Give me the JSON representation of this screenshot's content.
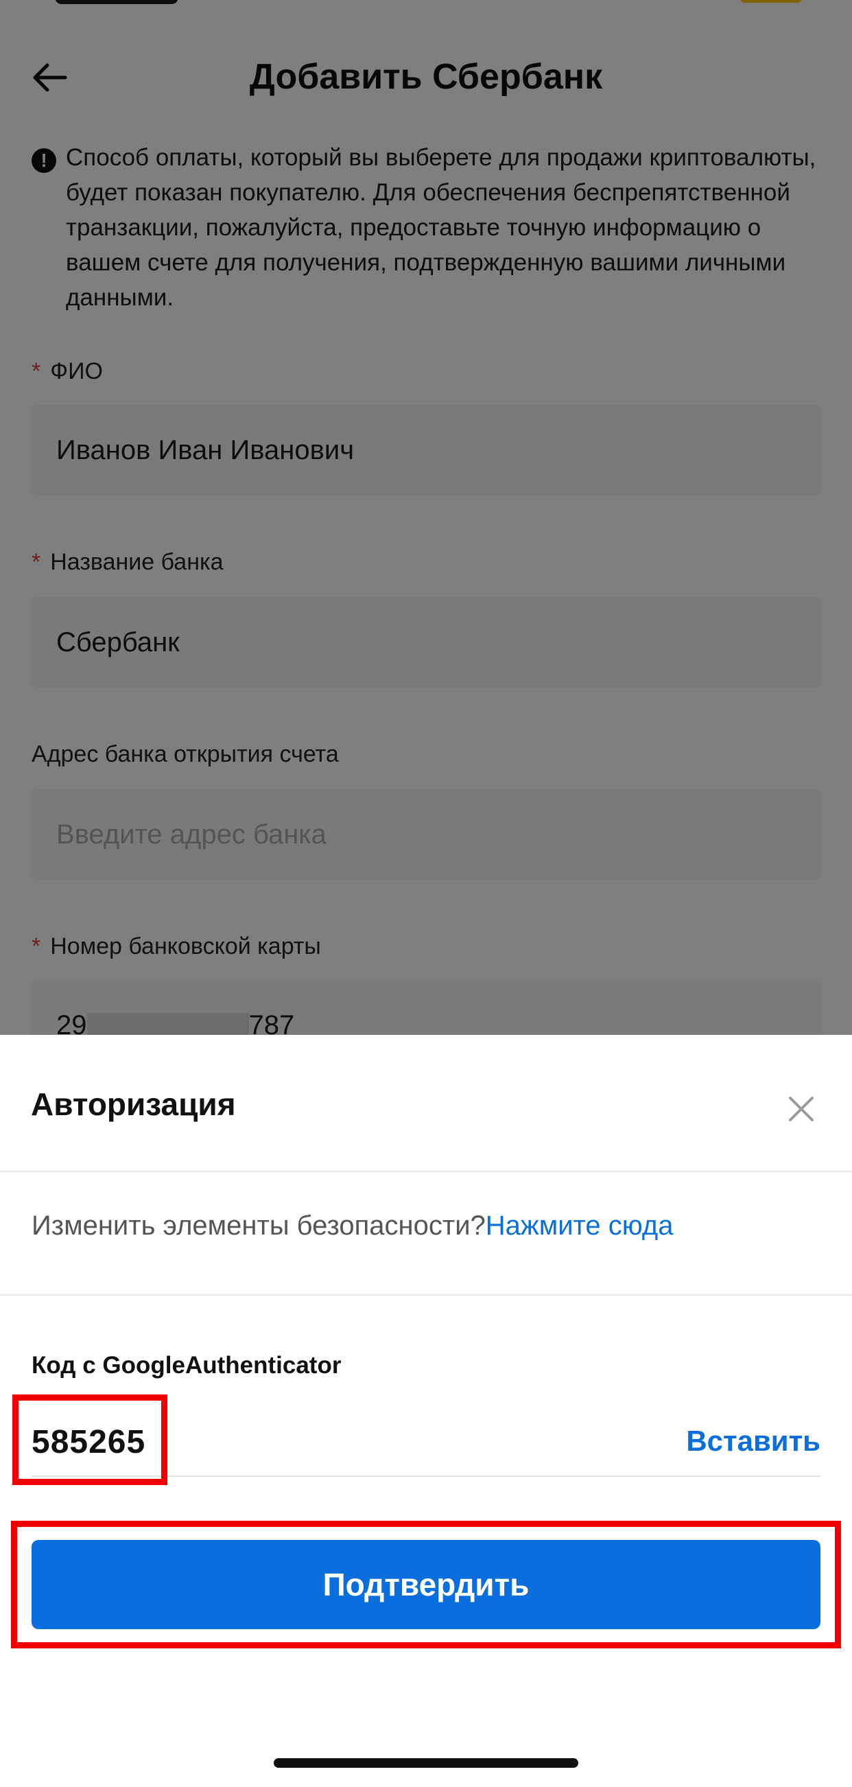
{
  "header": {
    "title": "Добавить Сбербанк"
  },
  "notice": {
    "text": "Способ оплаты, который вы выберете для продажи криптовалюты, будет показан покупателю. Для обеспечения беспрепятственной транзакции, пожалуйста, предоставьте точную информацию о вашем счете для получения, подтвержденную вашими личными данными."
  },
  "form": {
    "required_mark": "*",
    "fio": {
      "label": "ФИО",
      "value": "Иванов Иван Иванович"
    },
    "bank_name": {
      "label": "Название банка",
      "value": "Сбербанк"
    },
    "bank_address": {
      "label": "Адрес банка открытия счета",
      "placeholder": "Введите адрес банка"
    },
    "card_number": {
      "label": "Номер банковской карты",
      "prefix": "29",
      "suffix": "787"
    }
  },
  "auth_sheet": {
    "title": "Авторизация",
    "security_text": "Изменить элементы безопасности?",
    "security_link": "Нажмите сюда",
    "code_label": "Код с GoogleAuthenticator",
    "code_value": "585265",
    "paste_label": "Вставить",
    "confirm_label": "Подтвердить"
  },
  "colors": {
    "accent": "#0a6fdc",
    "highlight": "#f20000",
    "required": "#e03c3c"
  }
}
